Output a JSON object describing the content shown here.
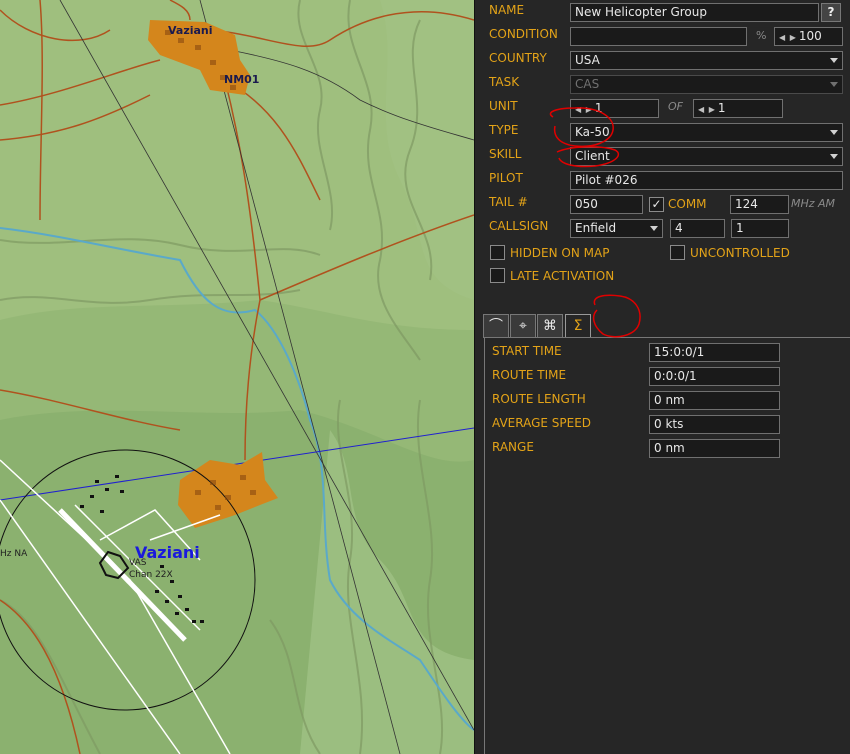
{
  "map": {
    "towns": [
      {
        "label": "Vaziani"
      },
      {
        "label": "NM01"
      }
    ],
    "airbase": {
      "label": "Vaziani",
      "tacan": "VAS",
      "channel": "Chan 22X",
      "freq": "Hz NA"
    }
  },
  "group": {
    "name_label": "NAME",
    "name_value": "New Helicopter Group",
    "help_label": "?",
    "condition_label": "CONDITION",
    "condition_value": "",
    "percent_label": "%",
    "percent_value": "100",
    "country_label": "COUNTRY",
    "country_value": "USA",
    "task_label": "TASK",
    "task_value": "CAS",
    "unit_label": "UNIT",
    "unit_value": "1",
    "of_label": "OF",
    "of_value": "1",
    "type_label": "TYPE",
    "type_value": "Ka-50",
    "skill_label": "SKILL",
    "skill_value": "Client",
    "pilot_label": "PILOT",
    "pilot_value": "Pilot #026",
    "tail_label": "TAIL #",
    "tail_value": "050",
    "comm_label": "COMM",
    "comm_value": "124",
    "comm_unit": "MHz AM",
    "callsign_label": "CALLSIGN",
    "callsign_value": "Enfield",
    "callsign_num1": "4",
    "callsign_num2": "1",
    "hidden_label": "HIDDEN ON MAP",
    "uncontrolled_label": "UNCONTROLLED",
    "late_label": "LATE ACTIVATION",
    "comm_checked": "✓"
  },
  "tabs": [
    {
      "icon": "route-icon",
      "glyph": "⌒"
    },
    {
      "icon": "target-icon",
      "glyph": "⌖"
    },
    {
      "icon": "payload-icon",
      "glyph": "⌘"
    },
    {
      "icon": "summary-icon",
      "glyph": "Σ"
    }
  ],
  "summary": {
    "start_time_label": "START TIME",
    "start_time_value": "15:0:0/1",
    "route_time_label": "ROUTE TIME",
    "route_time_value": "0:0:0/1",
    "route_length_label": "ROUTE LENGTH",
    "route_length_value": "0 nm",
    "avg_speed_label": "AVERAGE SPEED",
    "avg_speed_value": "0 kts",
    "range_label": "RANGE",
    "range_value": "0 nm"
  },
  "colors": {
    "label": "#e3a318",
    "map_bg": "#9fbf7e",
    "town": "#d4861c",
    "road": "#b0521e",
    "river": "#5aa9c9",
    "annotation": "#e00000"
  }
}
